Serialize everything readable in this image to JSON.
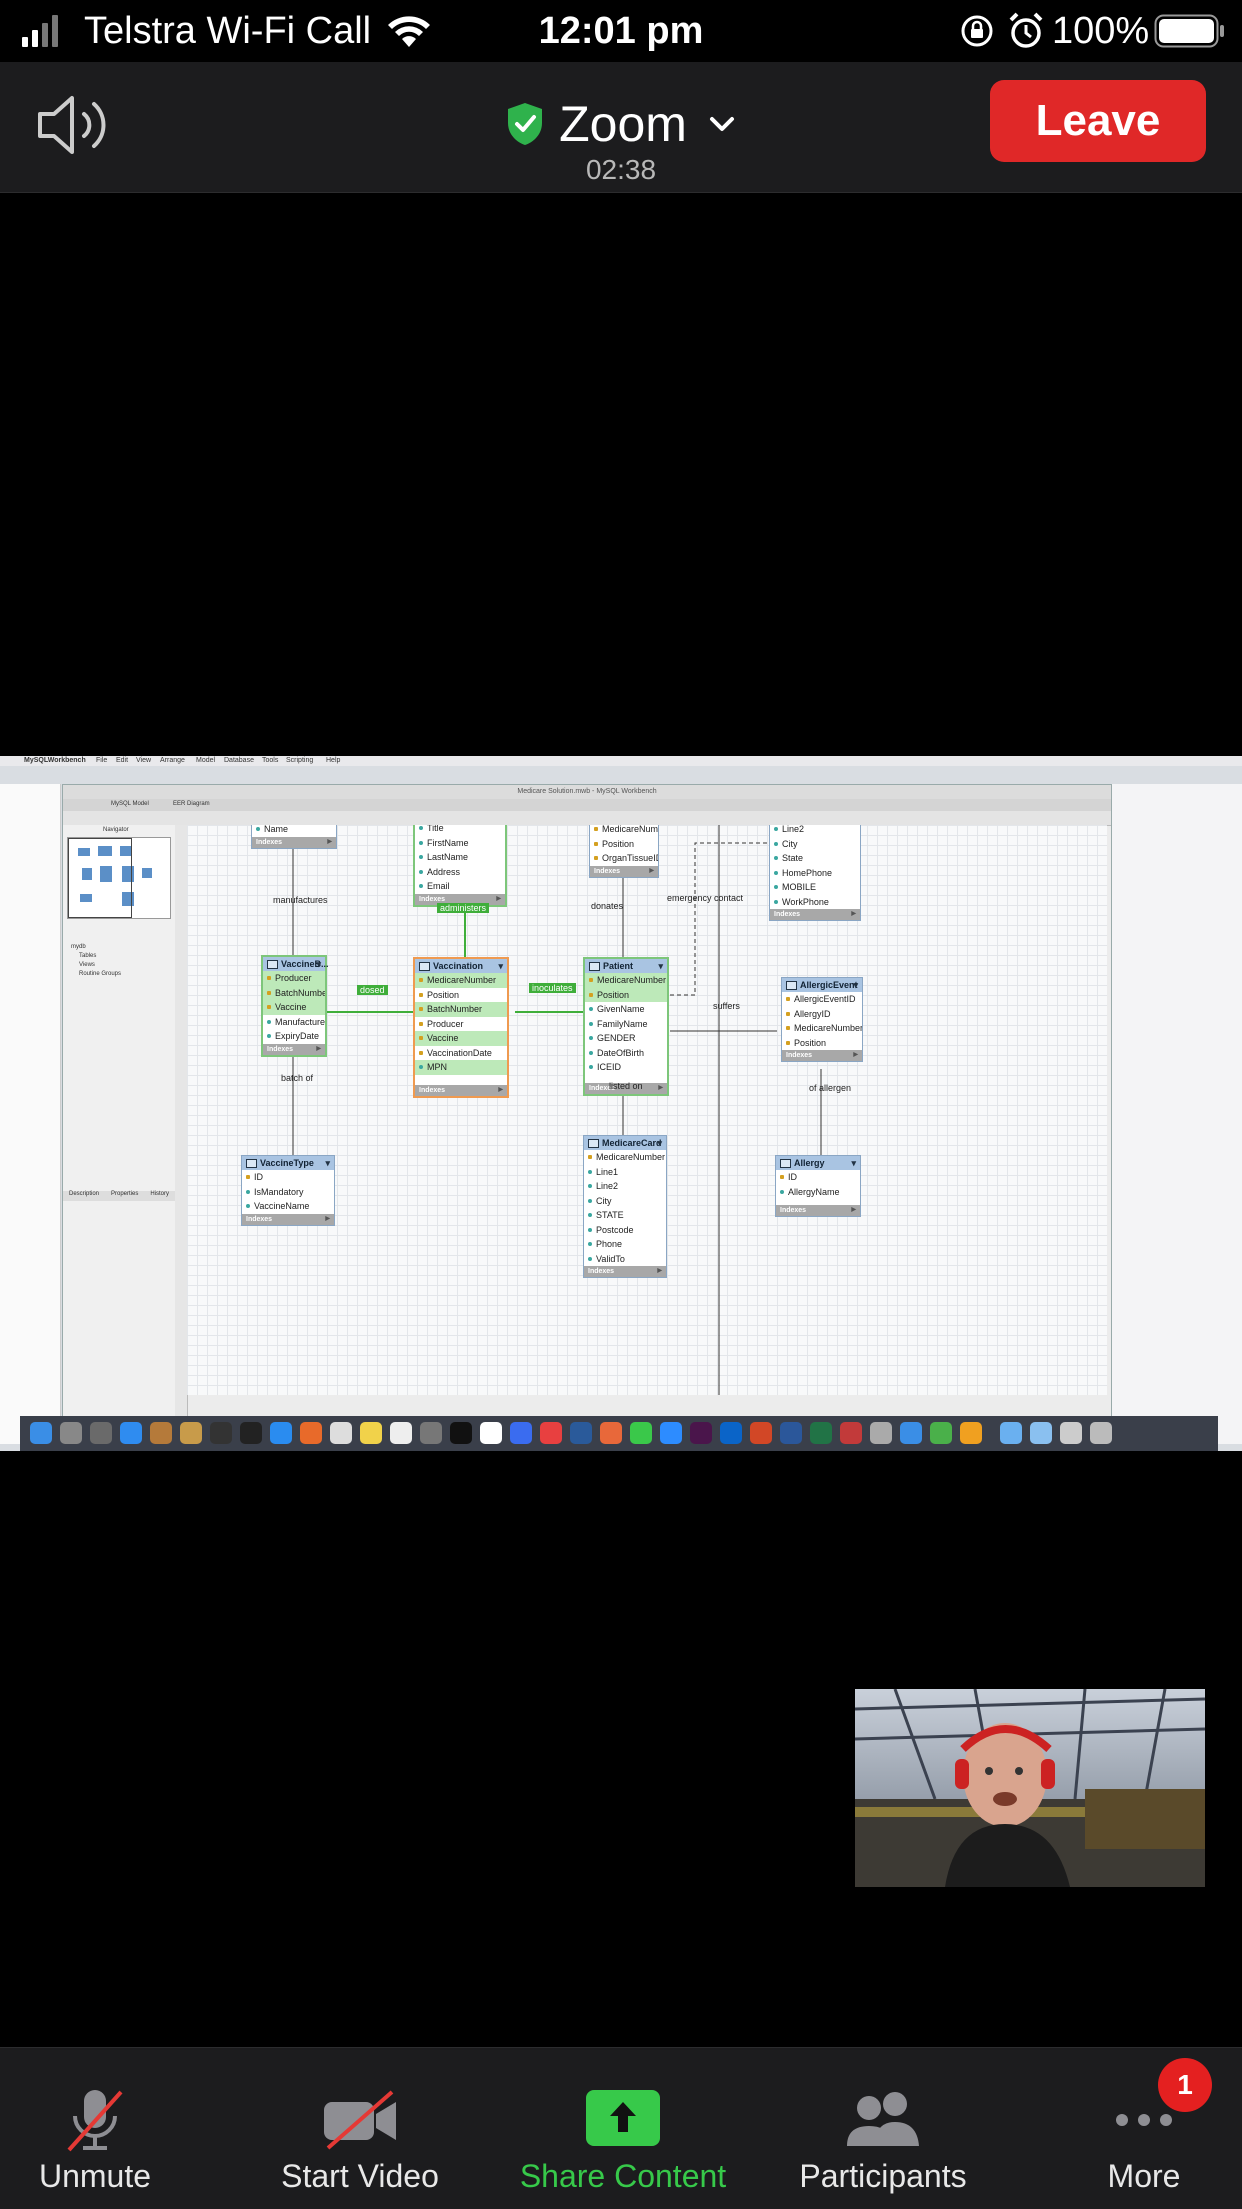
{
  "status_bar": {
    "carrier": "Telstra Wi-Fi Call",
    "time": "12:01 pm",
    "battery": "100%"
  },
  "header": {
    "title": "Zoom",
    "timer": "02:38",
    "leave_label": "Leave"
  },
  "shared_screen": {
    "mac_menu": [
      "MySQLWorkbench",
      "File",
      "Edit",
      "View",
      "Arrange",
      "Model",
      "Database",
      "Tools",
      "Scripting",
      "Help"
    ],
    "window_title": "Medicare Solution.mwb - MySQL Workbench",
    "tabs": [
      "MySQL Model",
      "EER Diagram"
    ],
    "sidebar": {
      "navigator": "Navigator",
      "tree": [
        "mydb",
        "Tables",
        "Views",
        "Routine Groups"
      ],
      "bottom_tabs": [
        "Description",
        "Properties",
        "History"
      ]
    },
    "tables": {
      "manufacturer": {
        "rows": [
          "Name"
        ],
        "indexes": "Indexes"
      },
      "person": {
        "rows": [
          "Title",
          "FirstName",
          "LastName",
          "Address",
          "Email"
        ],
        "indexes": "Indexes"
      },
      "organ": {
        "rows": [
          "MedicareNumber",
          "Position",
          "OrganTissueID"
        ],
        "indexes": "Indexes"
      },
      "contact": {
        "rows": [
          "Line2",
          "City",
          "State",
          "HomePhone",
          "MOBILE",
          "WorkPhone"
        ],
        "indexes": "Indexes"
      },
      "vaccine_batch": {
        "name": "VaccineB...",
        "rows": [
          "Producer",
          "BatchNumber",
          "Vaccine",
          "ManufactureDate",
          "ExpiryDate"
        ],
        "indexes": "Indexes"
      },
      "vaccination": {
        "name": "Vaccination",
        "rows": [
          "MedicareNumber",
          "Position",
          "BatchNumber",
          "Producer",
          "Vaccine",
          "VaccinationDate",
          "MPN"
        ],
        "indexes": "Indexes"
      },
      "patient": {
        "name": "Patient",
        "rows": [
          "MedicareNumber",
          "Position",
          "GivenName",
          "FamilyName",
          "GENDER",
          "DateOfBirth",
          "ICEID"
        ],
        "indexes": "Indexes"
      },
      "allergic_event": {
        "name": "AllergicEvent",
        "rows": [
          "AllergicEventID",
          "AllergyID",
          "MedicareNumber",
          "Position"
        ],
        "indexes": "Indexes"
      },
      "vaccine_type": {
        "name": "VaccineType",
        "rows": [
          "ID",
          "IsMandatory",
          "VaccineName"
        ],
        "indexes": "Indexes"
      },
      "medicare_card": {
        "name": "MedicareCard",
        "rows": [
          "MedicareNumber",
          "Line1",
          "Line2",
          "City",
          "STATE",
          "Postcode",
          "Phone",
          "ValidTo"
        ],
        "indexes": "Indexes"
      },
      "allergy": {
        "name": "Allergy",
        "rows": [
          "ID",
          "AllergyName"
        ],
        "indexes": "Indexes"
      }
    },
    "relationships": {
      "manufactures": "manufactures",
      "administers": "administers",
      "donates": "donates",
      "emergency_contact": "emergency contact",
      "dosed": "dosed",
      "inoculates": "inoculates",
      "suffers": "suffers",
      "batch_of": "batch of",
      "listed_on": "listed on",
      "of_allergen": "of allergen"
    }
  },
  "toolbar": {
    "unmute": "Unmute",
    "start_video": "Start Video",
    "share_content": "Share Content",
    "participants": "Participants",
    "more": "More",
    "more_badge": "1"
  },
  "colors": {
    "leave": "#e02828",
    "share_green": "#37c94a",
    "badge": "#e42020",
    "shield": "#2fb24c"
  }
}
